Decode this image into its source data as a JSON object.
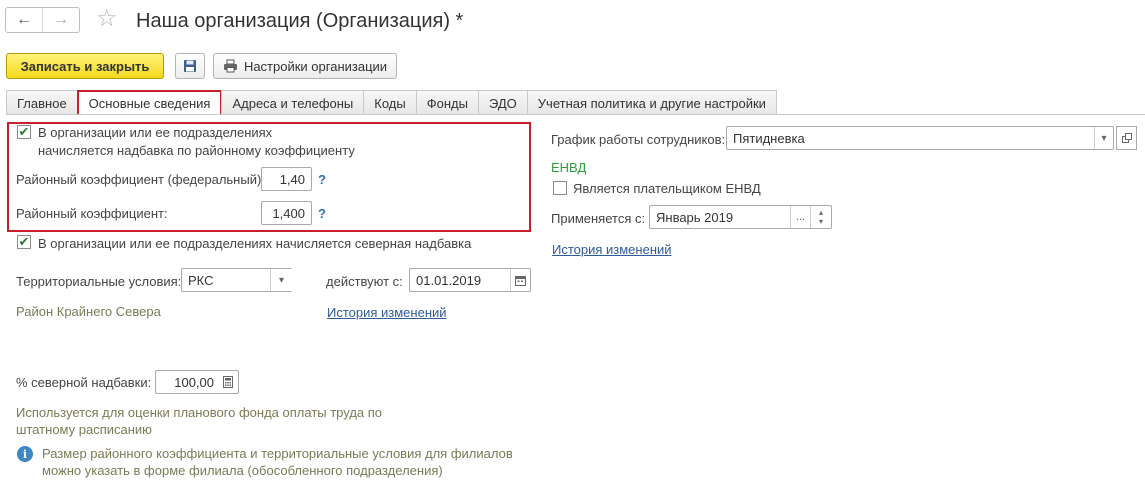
{
  "window": {
    "title": "Наша организация (Организация) *",
    "nav_back_icon": "arrow-left-icon",
    "nav_forward_icon": "arrow-right-icon",
    "favorite_icon": "star-icon"
  },
  "toolbar": {
    "save_close_label": "Записать и закрыть",
    "save_icon": "floppy-disk-icon",
    "settings_label": "Настройки организации",
    "settings_icon": "printer-icon"
  },
  "tabs": [
    {
      "label": "Главное",
      "active": false
    },
    {
      "label": "Основные сведения",
      "active": true
    },
    {
      "label": "Адреса и телефоны",
      "active": false
    },
    {
      "label": "Коды",
      "active": false
    },
    {
      "label": "Фонды",
      "active": false
    },
    {
      "label": "ЭДО",
      "active": false
    },
    {
      "label": "Учетная политика и другие настройки",
      "active": false
    }
  ],
  "regional": {
    "checkbox_line1": "В организации или ее подразделениях",
    "checkbox_line2": "начисляется надбавка по районному коэффициенту",
    "checked": true,
    "federal_label": "Районный коэффициент (федеральный):",
    "federal_value": "1,40",
    "coef_label": "Районный коэффициент:",
    "coef_value": "1,400",
    "help": "?"
  },
  "northern": {
    "checkbox_label": "В организации или ее подразделениях начисляется северная надбавка",
    "checked": true,
    "territory_label": "Территориальные условия:",
    "territory_value": "РКС",
    "valid_from_label": "действуют с:",
    "valid_from_value": "01.01.2019",
    "territory_hint": "Район Крайнего Севера",
    "history_link": "История изменений",
    "percent_label": "% северной надбавки:",
    "percent_value": "100,00",
    "usage_note_line1": "Используется для оценки планового фонда оплаты труда по",
    "usage_note_line2": "штатному расписанию",
    "info_line1": "Размер районного коэффициента и территориальные условия для филиалов",
    "info_line2": "можно указать в форме филиала (обособленного подразделения)"
  },
  "right": {
    "schedule_label": "График работы сотрудников:",
    "schedule_value": "Пятидневка",
    "envd_heading": "ЕНВД",
    "envd_checkbox_label": "Является плательщиком ЕНВД",
    "envd_checked": false,
    "applies_label": "Применяется с:",
    "applies_value": "Январь 2019",
    "history_link": "История изменений"
  },
  "colors": {
    "primary_button": "#f3d91d",
    "highlight_border": "#c8202b",
    "link": "#2e5b9a",
    "heading_green": "#2e9e3e",
    "hint_olive": "#7a7a57"
  }
}
